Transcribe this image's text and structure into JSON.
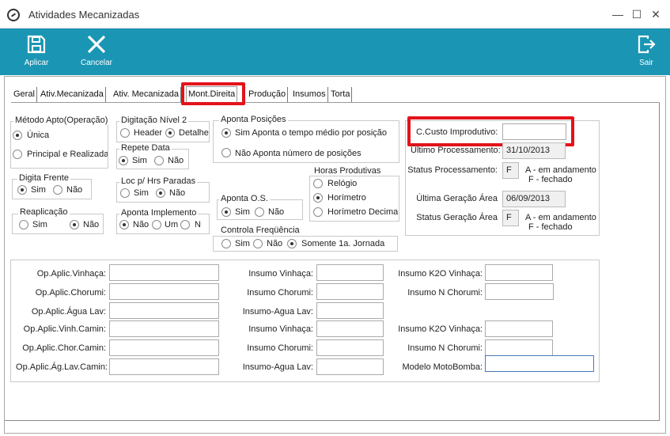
{
  "window": {
    "title": "Atividades Mecanizadas",
    "controls": {
      "minimize": "—",
      "maximize": "☐",
      "close": "✕"
    }
  },
  "toolbar": {
    "apply_label": "Aplicar",
    "cancel_label": "Cancelar",
    "exit_label": "Sair",
    "background": "#1a96b4"
  },
  "tabs": [
    "Geral",
    "Ativ.Mecanizada",
    "Ativ. Mecanizada",
    "Mont.Direita",
    "Produção",
    "Insumos",
    "Torta"
  ],
  "active_tab": "Mont.Direita",
  "highlight_color": "#e3131b",
  "groups": {
    "metodo_apto": {
      "label": "Método Apto(Operação)",
      "options": [
        "Única",
        "Principal e Realizada"
      ],
      "selected": "Única"
    },
    "digitacao_nivel2": {
      "label": "Digitação Nível 2",
      "options": [
        "Header",
        "Detalhe"
      ],
      "selected": "Detalhe"
    },
    "repete_data": {
      "label": "Repete Data",
      "options": [
        "Sim",
        "Não"
      ],
      "selected": "Sim"
    },
    "aponta_posicoes": {
      "label": "Aponta Posições",
      "options": [
        "Sim  Aponta o tempo médio por posição",
        "Não  Aponta número de posições"
      ],
      "selected": "Sim  Aponta o tempo médio por posição"
    },
    "digita_frente": {
      "label": "Digita Frente",
      "options": [
        "Sim",
        "Não"
      ],
      "selected": "Sim"
    },
    "loc_hrs_paradas": {
      "label": "Loc p/ Hrs Paradas",
      "options": [
        "Sim",
        "Não"
      ],
      "selected": "Não"
    },
    "horas_produtivas": {
      "label": "Horas Produtivas",
      "options": [
        "Relógio",
        "Horímetro",
        "Horímetro Decimal"
      ],
      "selected": "Horímetro"
    },
    "aponta_os": {
      "label": "Aponta O.S.",
      "options": [
        "Sim",
        "Não"
      ],
      "selected": "Sim"
    },
    "reaplicacao": {
      "label": "Reaplicação",
      "options": [
        "Sim",
        "Não"
      ],
      "selected": "Não"
    },
    "aponta_implemento": {
      "label": "Aponta Implemento",
      "options": [
        "Não",
        "Um",
        "N"
      ],
      "selected": "Não"
    },
    "controla_frequencia": {
      "label": "Controla Freqüência",
      "options": [
        "Sim",
        "Não",
        "Somente 1a. Jornada"
      ],
      "selected": "Somente 1a. Jornada"
    }
  },
  "status_panel": {
    "ccusto_label": "C.Custo Improdutivo:",
    "ccusto_value": "",
    "ultimo_proc_label": "Último Processamento:",
    "ultimo_proc_value": "31/10/2013",
    "status_proc_label": "Status Processamento:",
    "status_proc_value": "F",
    "legend_a": "A - em andamento",
    "legend_f": "F - fechado",
    "ultima_ger_label": "Última Geração Área",
    "ultima_ger_value": "06/09/2013",
    "status_ger_label": "Status Geração Área",
    "status_ger_value": "F"
  },
  "lower_fields": {
    "col1": [
      "Op.Aplic.Vinhaça:",
      "Op.Aplic.Chorumi:",
      "Op.Aplic.Água Lav:",
      "Op.Aplic.Vinh.Camin:",
      "Op.Aplic.Chor.Camin:",
      "Op.Aplic.Ág.Lav.Camin:"
    ],
    "col2": [
      "Insumo Vinhaça:",
      "Insumo Chorumi:",
      "Insumo-Agua Lav:",
      "Insumo Vinhaça:",
      "Insumo Chorumi:",
      "Insumo-Agua Lav:"
    ],
    "col3": [
      "Insumo K2O Vinhaça:",
      "Insumo N Chorumi:",
      "Insumo K2O Vinhaça:",
      "Insumo N Chorumi:",
      "Modelo MotoBomba:"
    ]
  }
}
